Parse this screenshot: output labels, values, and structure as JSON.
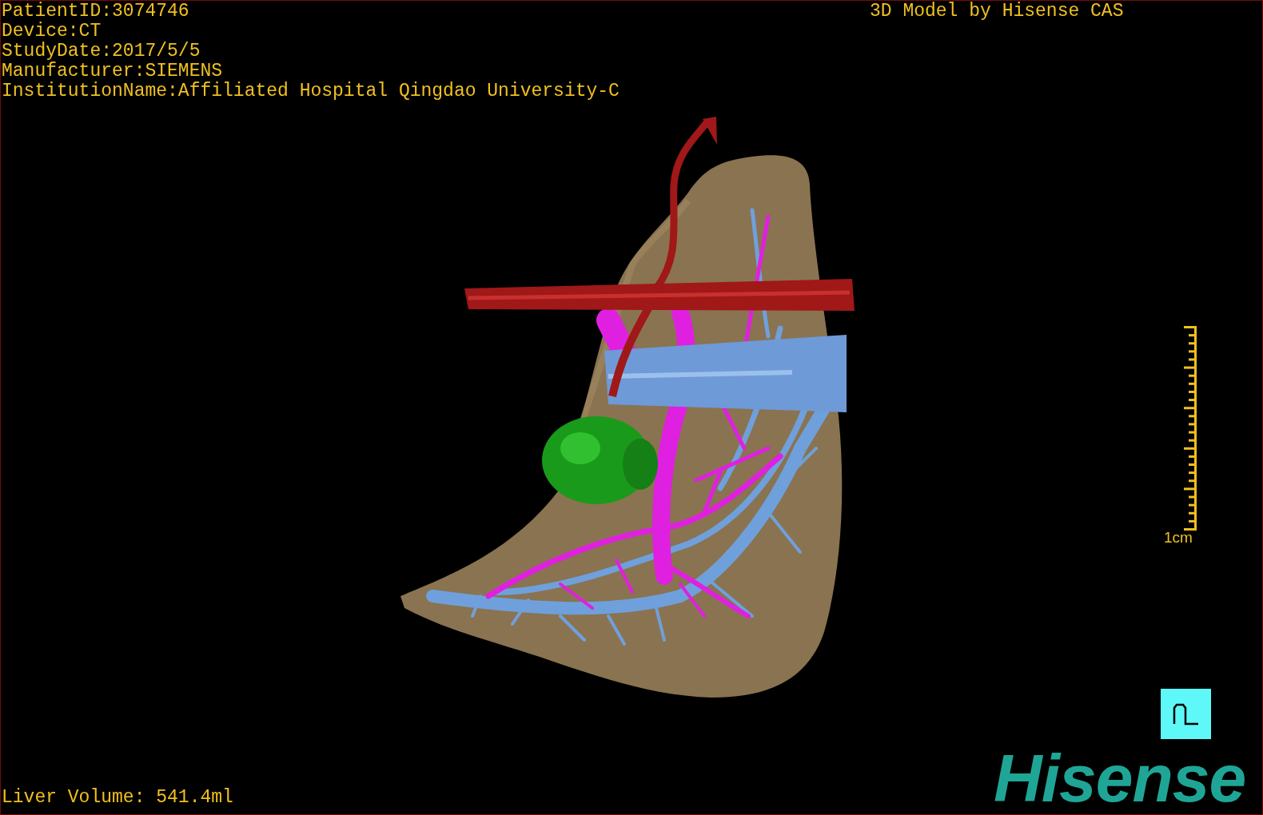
{
  "info_lines": [
    "PatientID:3074746",
    "Device:CT",
    "StudyDate:2017/5/5",
    "Manufacturer:SIEMENS",
    "InstitutionName:Affiliated Hospital Qingdao University-C"
  ],
  "title": "3D Model by Hisense CAS",
  "scale_bar": {
    "label": "1cm"
  },
  "volume": "Liver Volume: 541.4ml",
  "logo": "Hisense"
}
